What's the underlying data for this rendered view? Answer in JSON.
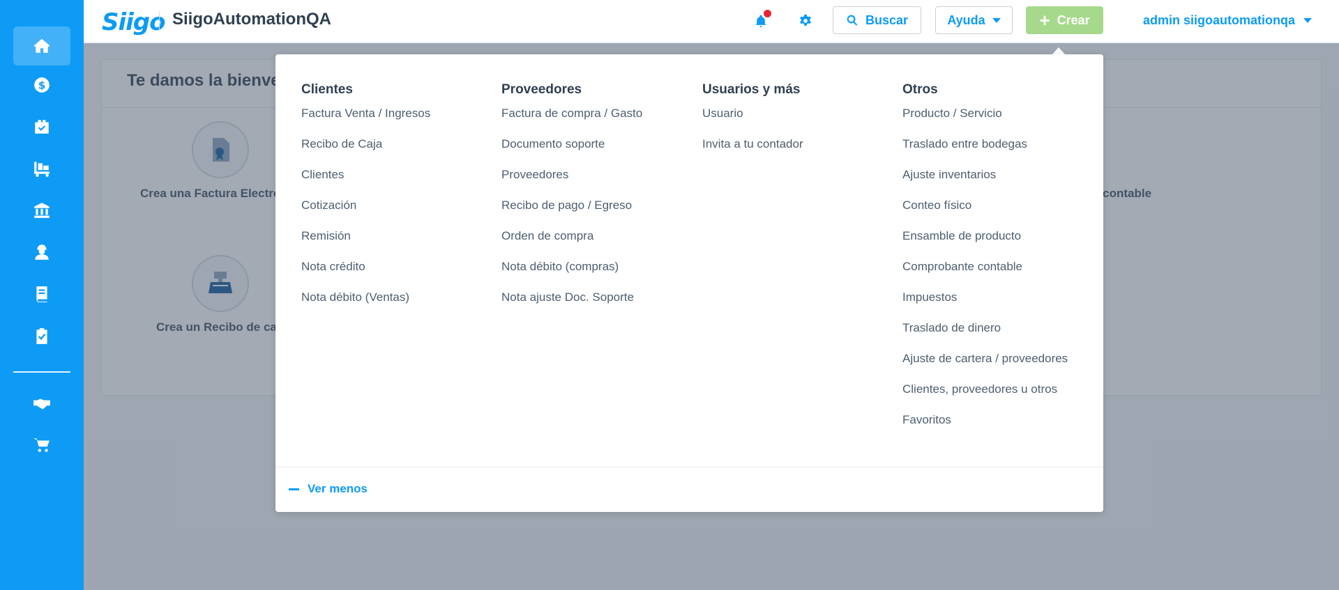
{
  "header": {
    "logo_text": "Siigo",
    "app_title": "SiigoAutomationQA",
    "search_label": "Buscar",
    "help_label": "Ayuda",
    "create_label": "Crear",
    "user_label": "admin siigoautomationqa"
  },
  "sidebar": {
    "items": [
      {
        "icon": "home-icon",
        "active": true
      },
      {
        "icon": "dollar-icon"
      },
      {
        "icon": "shopping-bag-icon"
      },
      {
        "icon": "inventory-cart-icon"
      },
      {
        "icon": "bank-icon"
      },
      {
        "icon": "worker-icon"
      },
      {
        "icon": "book-icon"
      },
      {
        "icon": "clipboard-check-icon"
      },
      {
        "icon": "handshake-icon"
      },
      {
        "icon": "shopping-cart-icon"
      }
    ]
  },
  "welcome": {
    "title": "Te damos la bienve",
    "shortcut1": "Crea una Factura Electró",
    "shortcut2": "Crea un Recibo de ca",
    "shortcut3": "e contable"
  },
  "create_menu": {
    "columns": [
      {
        "title": "Clientes",
        "items": [
          "Factura Venta / Ingresos",
          "Recibo de Caja",
          "Clientes",
          "Cotización",
          "Remisión",
          "Nota crédito",
          "Nota débito (Ventas)"
        ]
      },
      {
        "title": "Proveedores",
        "items": [
          "Factura de compra / Gasto",
          "Documento soporte",
          "Proveedores",
          "Recibo de pago / Egreso",
          "Orden de compra",
          "Nota débito (compras)",
          "Nota ajuste Doc. Soporte"
        ]
      },
      {
        "title": "Usuarios y más",
        "items": [
          "Usuario",
          "Invita a tu contador"
        ]
      },
      {
        "title": "Otros",
        "items": [
          "Producto / Servicio",
          "Traslado entre bodegas",
          "Ajuste inventarios",
          "Conteo físico",
          "Ensamble de producto",
          "Comprobante contable",
          "Impuestos",
          "Traslado de dinero",
          "Ajuste de cartera / proveedores",
          "Clientes, proveedores u otros",
          "Favoritos"
        ]
      }
    ],
    "footer_label": "Ver menos"
  },
  "colors": {
    "brand": "#0d9bf5",
    "create_button": "#a7d98c",
    "notification_dot": "#e52535"
  }
}
